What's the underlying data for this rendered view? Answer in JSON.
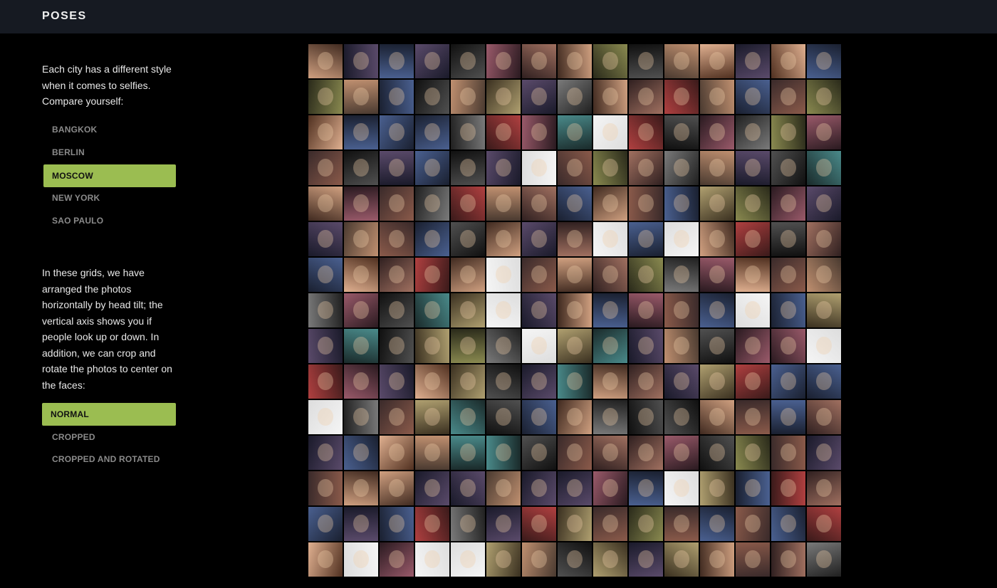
{
  "header": {
    "title": "POSES"
  },
  "sidebar": {
    "intro": "Each city has a different style when it comes to selfies. Compare yourself:",
    "cities": [
      "BANGKOK",
      "BERLIN",
      "MOSCOW",
      "NEW YORK",
      "SAO PAULO"
    ],
    "selected_city": "MOSCOW",
    "explain": "In these grids, we have arranged the photos horizontally by head tilt; the vertical axis shows you if people look up or down. In addition, we can crop and rotate the photos to center on the faces:",
    "modes": [
      "NORMAL",
      "CROPPED",
      "CROPPED AND ROTATED"
    ],
    "selected_mode": "NORMAL"
  },
  "colors": {
    "accent": "#9bbd51",
    "header_bg": "#161a22",
    "page_bg": "#000000"
  }
}
